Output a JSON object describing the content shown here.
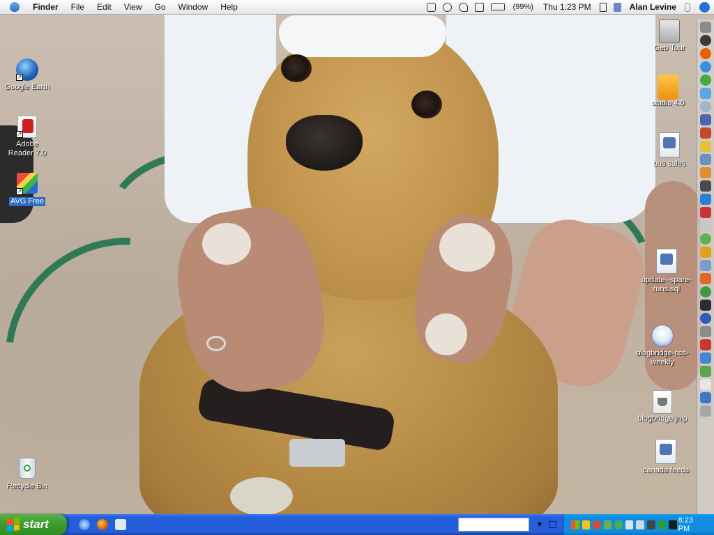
{
  "menubar": {
    "app_name": "Finder",
    "menus": [
      "File",
      "Edit",
      "View",
      "Go",
      "Window",
      "Help"
    ],
    "battery": "(99%)",
    "clock": "Thu 1:23 PM",
    "user": "Alan Levine"
  },
  "desktop_left": [
    {
      "label": "Google Earth",
      "icon": "google-earth-icon",
      "shortcut": true
    },
    {
      "label": "Adobe Reader 7.0",
      "icon": "adobe-reader-icon",
      "shortcut": true
    },
    {
      "label": "AVG Free",
      "icon": "avg-icon",
      "shortcut": true,
      "selected": true
    },
    {
      "label": "Recycle Bin",
      "icon": "recycle-bin-icon",
      "shortcut": false
    }
  ],
  "desktop_right": [
    {
      "label": "Geo Tour",
      "icon": "hard-drive-icon"
    },
    {
      "label": "studio 4.0",
      "icon": "studio-icon"
    },
    {
      "label": "bus sales",
      "icon": "document-icon"
    },
    {
      "label": "update--spare-runs.sql",
      "icon": "sql-document-icon"
    },
    {
      "label": "blogbridge-ccs-weekly",
      "icon": "blogbridge-icon"
    },
    {
      "label": "blogbridge.jnlp",
      "icon": "jnlp-file-icon"
    },
    {
      "label": "canada feeds",
      "icon": "document-icon"
    }
  ],
  "taskbar": {
    "start_label": "start",
    "clock": "8:23 PM"
  },
  "colors": {
    "xp_blue": "#245edb",
    "start_green": "#3c9a2d",
    "tray_blue": "#0f8de0"
  }
}
